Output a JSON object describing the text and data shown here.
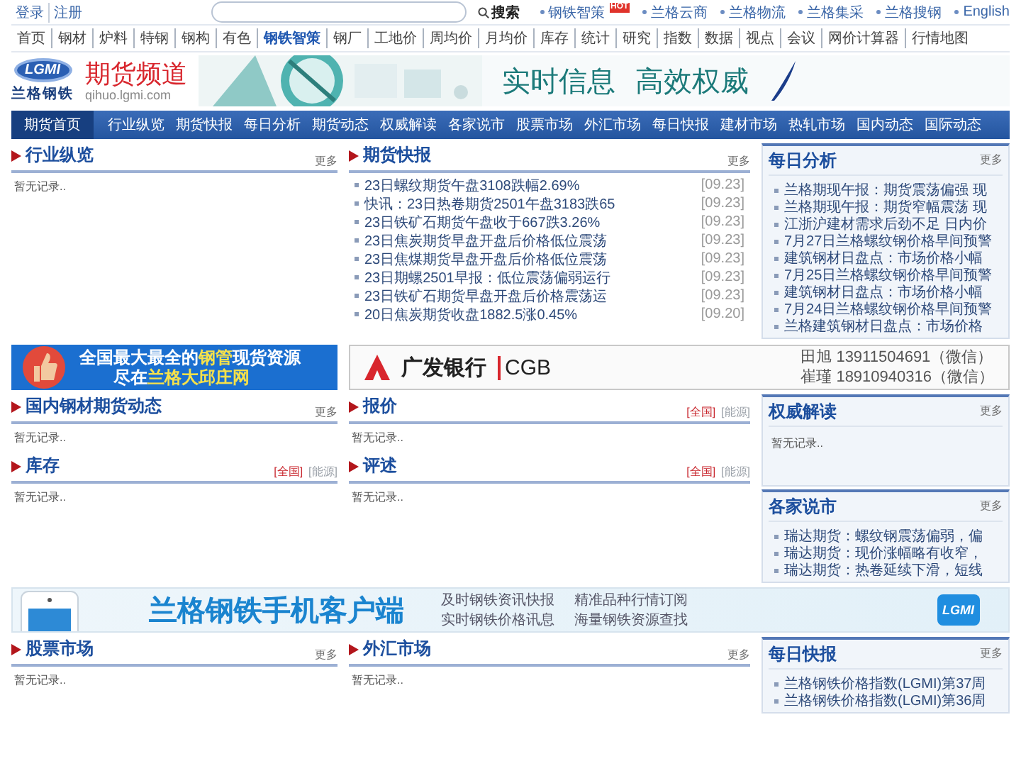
{
  "top_bar": {
    "account_links": [
      "登录",
      "注册"
    ],
    "search_button": "搜索",
    "site_links": [
      {
        "label": "钢铁智策",
        "badge": "HOT"
      },
      {
        "label": "兰格云商"
      },
      {
        "label": "兰格物流"
      },
      {
        "label": "兰格集采"
      },
      {
        "label": "兰格搜钢"
      },
      {
        "label": "English"
      }
    ]
  },
  "menu": [
    {
      "label": "首页",
      "selected": false
    },
    {
      "label": "钢材",
      "selected": false
    },
    {
      "label": "炉料",
      "selected": false
    },
    {
      "label": "特钢",
      "selected": false
    },
    {
      "label": "钢构",
      "selected": false
    },
    {
      "label": "有色",
      "selected": false
    },
    {
      "label": "钢铁智策",
      "selected": true
    },
    {
      "label": "钢厂",
      "selected": false
    },
    {
      "label": "工地价",
      "selected": false
    },
    {
      "label": "周均价",
      "selected": false
    },
    {
      "label": "月均价",
      "selected": false
    },
    {
      "label": "库存",
      "selected": false
    },
    {
      "label": "统计",
      "selected": false
    },
    {
      "label": "研究",
      "selected": false
    },
    {
      "label": "指数",
      "selected": false
    },
    {
      "label": "数据",
      "selected": false
    },
    {
      "label": "视点",
      "selected": false
    },
    {
      "label": "会议",
      "selected": false
    },
    {
      "label": "网价计算器",
      "selected": false
    },
    {
      "label": "行情地图",
      "selected": false
    }
  ],
  "header": {
    "logo_mark": "LGMI",
    "logo_name": "兰格钢铁",
    "channel": "期货频道",
    "domain": "qihuo.lgmi.com",
    "slogan": [
      "实时信息",
      "高效权威"
    ]
  },
  "nav": [
    {
      "label": "期货首页",
      "selected": true
    },
    {
      "label": "行业纵览",
      "selected": false
    },
    {
      "label": "期货快报",
      "selected": false
    },
    {
      "label": "每日分析",
      "selected": false
    },
    {
      "label": "期货动态",
      "selected": false
    },
    {
      "label": "权威解读",
      "selected": false
    },
    {
      "label": "各家说市",
      "selected": false
    },
    {
      "label": "股票市场",
      "selected": false
    },
    {
      "label": "外汇市场",
      "selected": false
    },
    {
      "label": "每日快报",
      "selected": false
    },
    {
      "label": "建材市场",
      "selected": false
    },
    {
      "label": "热轧市场",
      "selected": false
    },
    {
      "label": "国内动态",
      "selected": false
    },
    {
      "label": "国际动态",
      "selected": false
    }
  ],
  "top_section": {
    "overview": {
      "title": "行业纵览",
      "links": [
        {
          "label": "更多",
          "kind": "more"
        }
      ],
      "empty": "暂无记录.."
    },
    "futures_news": {
      "title": "期货快报",
      "links": [
        {
          "label": "更多",
          "kind": "more"
        }
      ],
      "items": [
        {
          "text": "23日螺纹期货午盘3108跌幅2.69%",
          "date": "[09.23]"
        },
        {
          "text": "快讯：23日热卷期货2501午盘3183跌65",
          "date": "[09.23]"
        },
        {
          "text": "23日铁矿石期货午盘收于667跌3.26%",
          "date": "[09.23]"
        },
        {
          "text": "23日焦炭期货早盘开盘后价格低位震荡",
          "date": "[09.23]"
        },
        {
          "text": "23日焦煤期货早盘开盘后价格低位震荡",
          "date": "[09.23]"
        },
        {
          "text": "23日期螺2501早报：低位震荡偏弱运行",
          "date": "[09.23]"
        },
        {
          "text": "23日铁矿石期货早盘开盘后价格震荡运",
          "date": "[09.23]"
        },
        {
          "text": "20日焦炭期货收盘1882.5涨0.45%",
          "date": "[09.20]"
        }
      ]
    },
    "daily_analysis": {
      "title": "每日分析",
      "links": [
        {
          "label": "更多",
          "kind": "more"
        }
      ],
      "items": [
        {
          "text": "兰格期现午报：期货震荡偏强 现"
        },
        {
          "text": "兰格期现午报：期货窄幅震荡 现"
        },
        {
          "text": "江浙沪建材需求后劲不足 日内价"
        },
        {
          "text": "7月27日兰格螺纹钢价格早间预警"
        },
        {
          "text": "建筑钢材日盘点：市场价格小幅"
        },
        {
          "text": "7月25日兰格螺纹钢价格早间预警"
        },
        {
          "text": "建筑钢材日盘点：市场价格小幅"
        },
        {
          "text": "7月24日兰格螺纹钢价格早间预警"
        },
        {
          "text": "兰格建筑钢材日盘点：市场价格"
        }
      ]
    }
  },
  "ads": {
    "pipe_ad": {
      "lines": [
        [
          {
            "text": "全国最大最全的",
            "highlight": false
          },
          {
            "text": "钢管",
            "highlight": true
          },
          {
            "text": "现货资源",
            "highlight": false
          }
        ],
        [
          {
            "text": "尽在",
            "highlight": false
          },
          {
            "text": "兰格大邱庄网",
            "highlight": true
          }
        ]
      ]
    },
    "bank_ad": {
      "name": "广发银行",
      "code": "CGB"
    },
    "contacts": [
      "田旭 13911504691（微信）",
      "崔瑾 18910940316（微信）"
    ]
  },
  "middle_section": {
    "left": [
      {
        "title": "国内钢材期货动态",
        "links": [
          {
            "label": "更多",
            "kind": "more"
          }
        ],
        "empty": "暂无记录.."
      },
      {
        "title": "库存",
        "links": [
          {
            "label": "[全国]",
            "kind": "region"
          },
          {
            "label": "[能源]",
            "kind": "category"
          }
        ],
        "empty": "暂无记录.."
      }
    ],
    "middle": [
      {
        "title": "报价",
        "links": [
          {
            "label": "[全国]",
            "kind": "region"
          },
          {
            "label": "[能源]",
            "kind": "category"
          }
        ],
        "empty": "暂无记录.."
      },
      {
        "title": "评述",
        "links": [
          {
            "label": "[全国]",
            "kind": "region"
          },
          {
            "label": "[能源]",
            "kind": "category"
          }
        ],
        "empty": "暂无记录.."
      }
    ],
    "right": [
      {
        "title": "权威解读",
        "links": [
          {
            "label": "更多",
            "kind": "more"
          }
        ],
        "empty": "暂无记录.."
      },
      {
        "title": "各家说市",
        "links": [
          {
            "label": "更多",
            "kind": "more"
          }
        ],
        "items": [
          {
            "text": "瑞达期货：螺纹钢震荡偏弱，偏"
          },
          {
            "text": "瑞达期货：现价涨幅略有收窄，"
          },
          {
            "text": "瑞达期货：热卷延续下滑，短线"
          }
        ]
      }
    ]
  },
  "app_banner": {
    "title": "兰格钢铁手机客户端",
    "features": [
      "及时钢铁资讯快报",
      "精准品种行情订阅",
      "实时钢铁价格讯息",
      "海量钢铁资源查找"
    ],
    "logo": "LGMI"
  },
  "bottom_section": {
    "left": {
      "title": "股票市场",
      "links": [
        {
          "label": "更多",
          "kind": "more"
        }
      ],
      "empty": "暂无记录.."
    },
    "middle": {
      "title": "外汇市场",
      "links": [
        {
          "label": "更多",
          "kind": "more"
        }
      ],
      "empty": "暂无记录.."
    },
    "right": {
      "title": "每日快报",
      "links": [
        {
          "label": "更多",
          "kind": "more"
        }
      ],
      "items": [
        {
          "text": "兰格钢铁价格指数(LGMI)第37周"
        },
        {
          "text": "兰格钢铁价格指数(LGMI)第36周"
        }
      ]
    }
  }
}
